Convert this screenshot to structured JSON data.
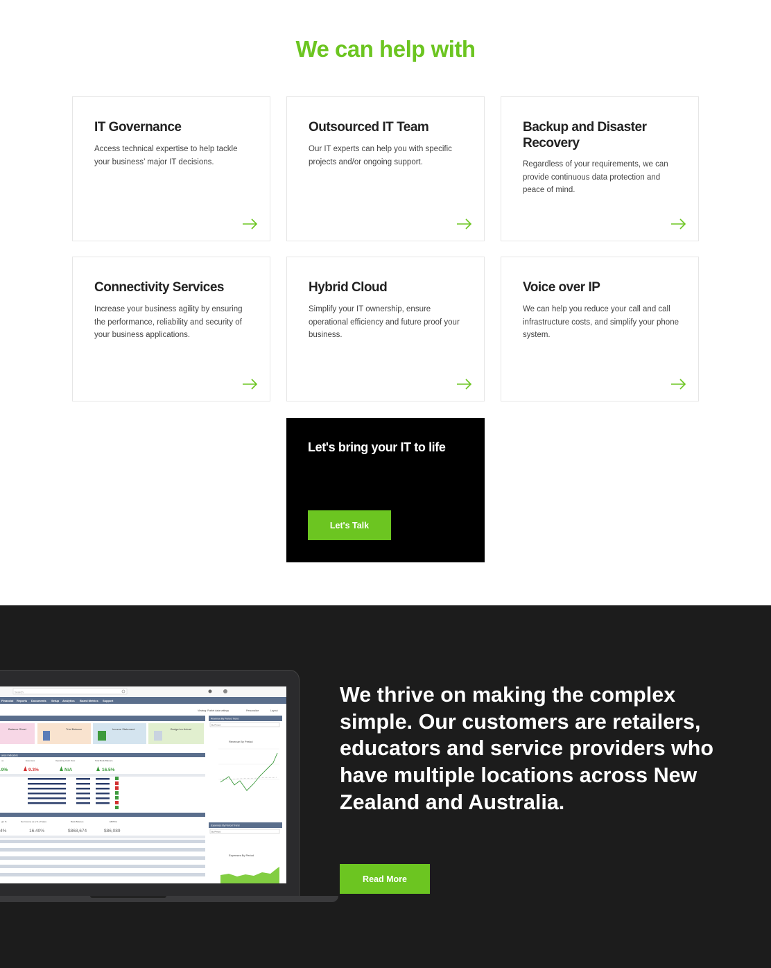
{
  "section": {
    "title": "We can help with"
  },
  "cards": [
    {
      "title": "IT Governance",
      "description": "Access technical expertise to help tackle your business’ major IT decisions."
    },
    {
      "title": "Outsourced IT Team",
      "description": "Our IT experts can help you with specific projects and/or ongoing support."
    },
    {
      "title": "Backup and Disaster Recovery",
      "description": "Regardless of your requirements, we can provide continuous data protection and peace of mind."
    },
    {
      "title": "Connectivity Services",
      "description": "Increase your business agility by ensuring the performance, reliability and security of your business applications."
    },
    {
      "title": "Hybrid Cloud",
      "description": "Simplify your IT ownership, ensure operational efficiency and future proof your business."
    },
    {
      "title": "Voice over IP",
      "description": "We can help you reduce your call and call infrastructure costs, and simplify your phone system."
    }
  ],
  "cta": {
    "title": "Let's bring your IT to life",
    "button": "Let's Talk"
  },
  "about": {
    "text": "We thrive on making the complex simple. Our customers are retailers, educators and service providers who have multiple locations across New Zealand and Australia.",
    "button": "Read More"
  },
  "dashboard": {
    "search_placeholder": "Search",
    "nav": [
      "Financial",
      "Reports",
      "Documents",
      "Setup",
      "Analytics",
      "Board Metrics",
      "Support"
    ],
    "tiles": [
      "Balance Sheet",
      "Trial Balance",
      "Income Statement",
      "Budget vs Actual"
    ],
    "kpi_header": "ance Indicators",
    "kpi_labels": [
      "ue",
      "Expenses",
      "Operating Cash Flow",
      "Total Bank Balance"
    ],
    "kpi_values": [
      ".9%",
      "9.3%",
      "N/A",
      "16.5%"
    ],
    "kpi2_labels": [
      "gin %",
      "Net Income as a % of Sales",
      "Bank Balance",
      "EBITDA"
    ],
    "kpi2_values": [
      "4%",
      "16.40%",
      "$868,674",
      "$86,089"
    ],
    "chart1_title": "Revenue By Period Trend",
    "chart1_subtitle": "Revenue By Period",
    "chart2_title": "Expenses By Period Trend",
    "chart2_subtitle": "Expenses By Period",
    "period_select": "By Period",
    "viewing": "Viewing: Portlet data settings",
    "personalize": "Personalize",
    "layout": "Layout",
    "colors": {
      "accent": "#6cc521",
      "dark_bg": "#1c1c1c",
      "nav_bar": "#5a6e8c"
    }
  }
}
